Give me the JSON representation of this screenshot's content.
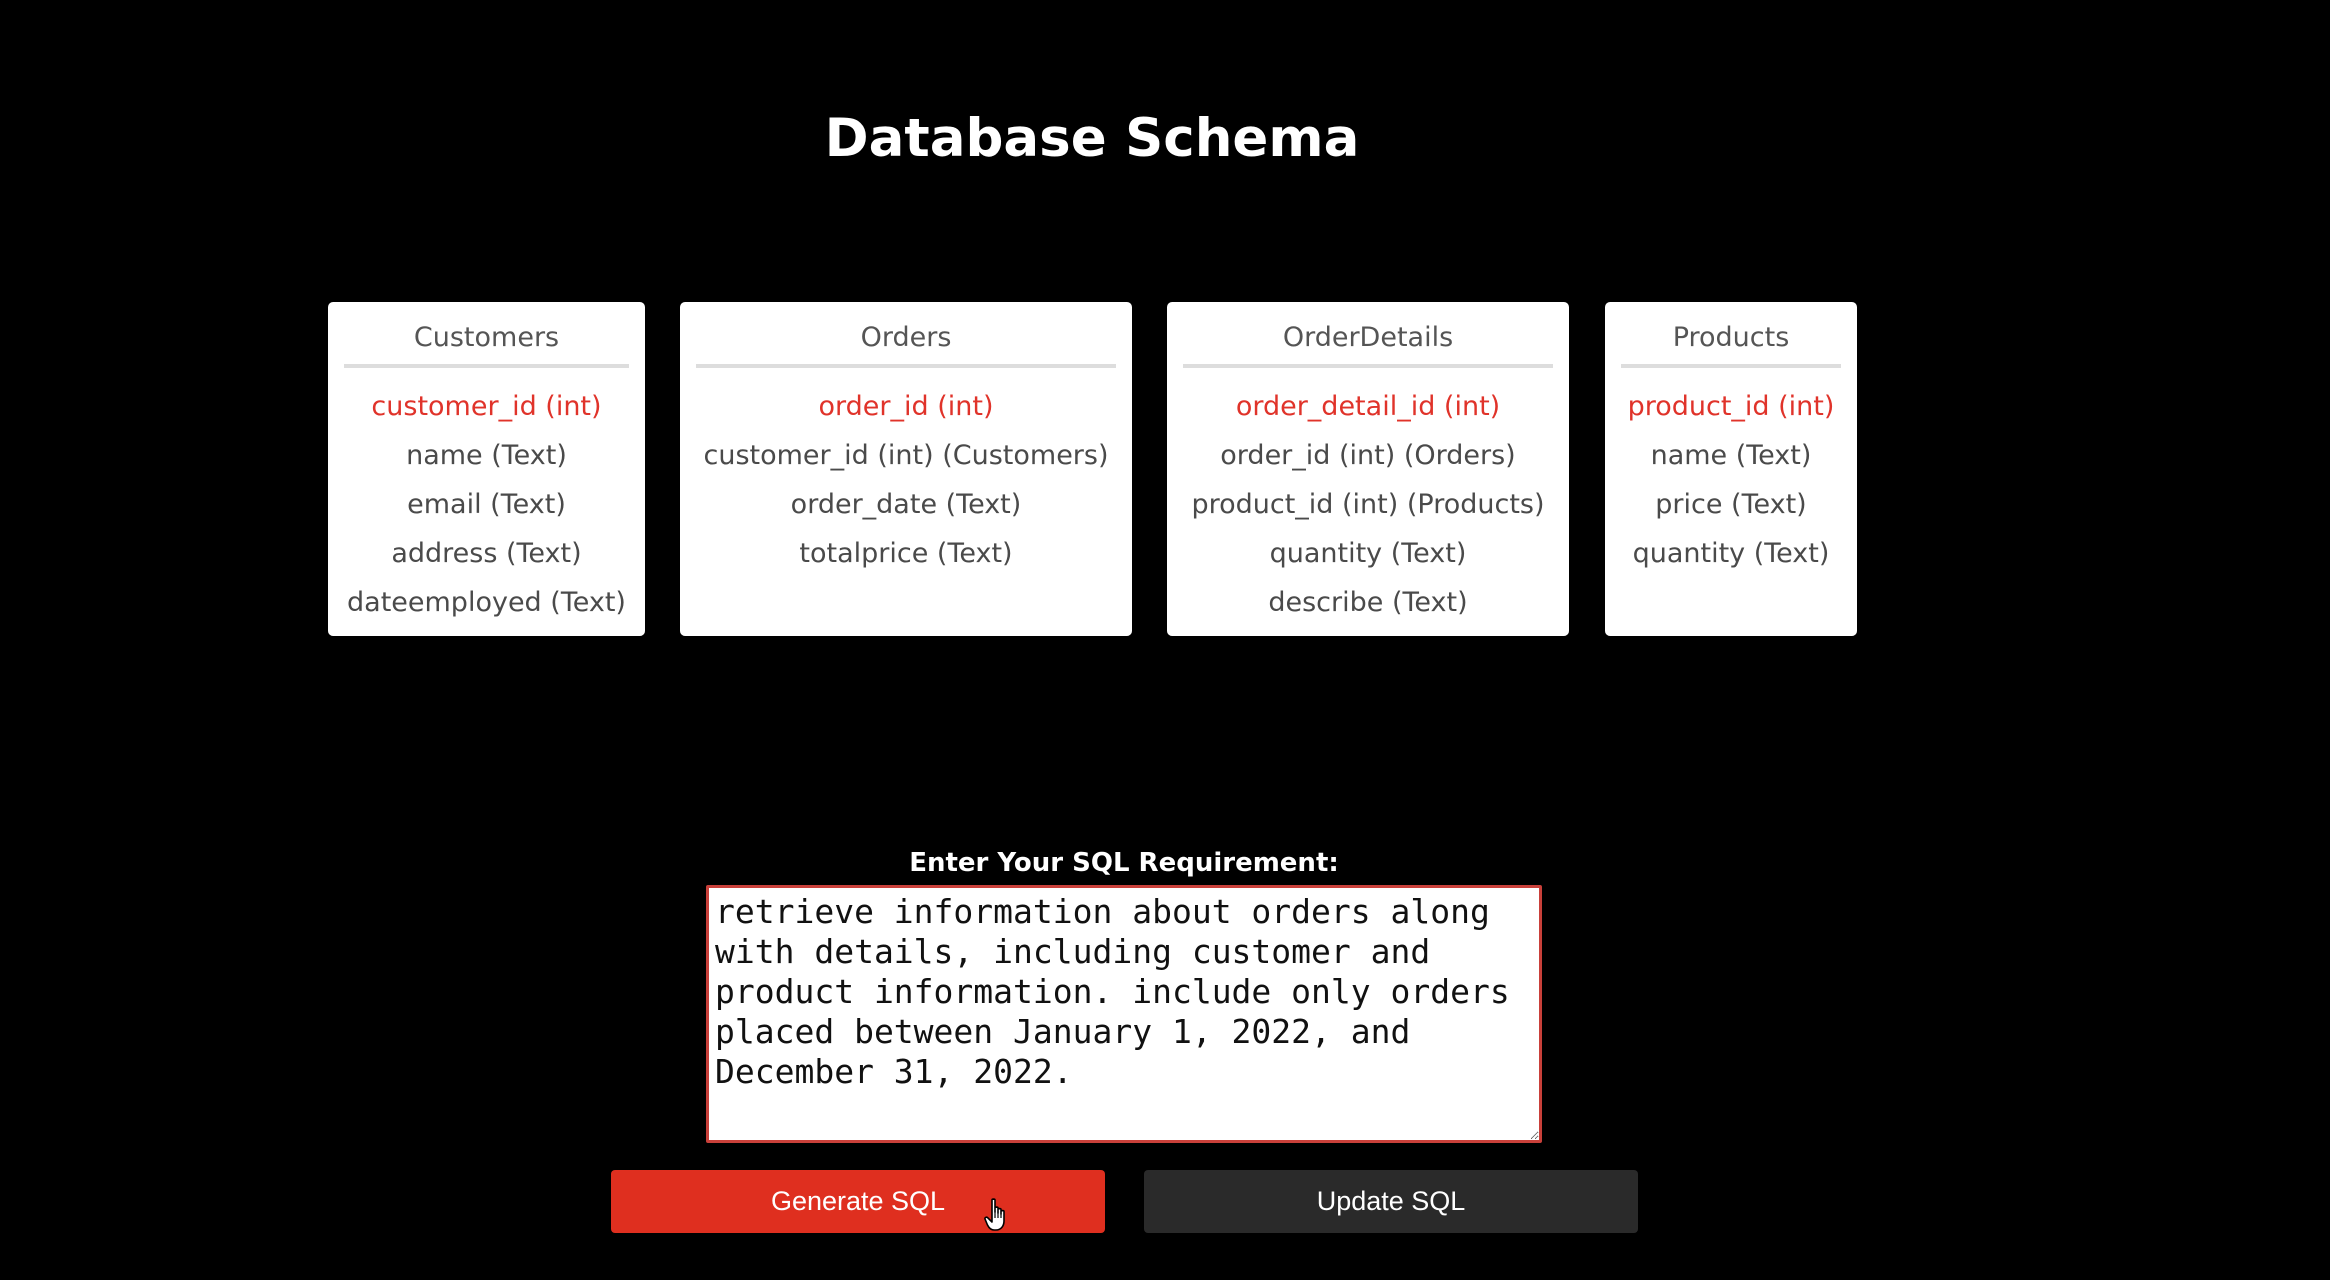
{
  "page": {
    "title": "Database Schema"
  },
  "tables": [
    {
      "name": "Customers",
      "columns": [
        {
          "label": "customer_id (int)",
          "primary": true
        },
        {
          "label": "name (Text)",
          "primary": false
        },
        {
          "label": "email (Text)",
          "primary": false
        },
        {
          "label": "address (Text)",
          "primary": false
        },
        {
          "label": "dateemployed (Text)",
          "primary": false
        }
      ]
    },
    {
      "name": "Orders",
      "columns": [
        {
          "label": "order_id (int)",
          "primary": true
        },
        {
          "label": "customer_id (int) (Customers)",
          "primary": false
        },
        {
          "label": "order_date (Text)",
          "primary": false
        },
        {
          "label": "totalprice (Text)",
          "primary": false
        }
      ]
    },
    {
      "name": "OrderDetails",
      "columns": [
        {
          "label": "order_detail_id (int)",
          "primary": true
        },
        {
          "label": "order_id (int) (Orders)",
          "primary": false
        },
        {
          "label": "product_id (int) (Products)",
          "primary": false
        },
        {
          "label": "quantity (Text)",
          "primary": false
        },
        {
          "label": "describe (Text)",
          "primary": false
        }
      ]
    },
    {
      "name": "Products",
      "columns": [
        {
          "label": "product_id (int)",
          "primary": true
        },
        {
          "label": "name (Text)",
          "primary": false
        },
        {
          "label": "price (Text)",
          "primary": false
        },
        {
          "label": "quantity (Text)",
          "primary": false
        }
      ]
    }
  ],
  "requirement": {
    "label": "Enter Your SQL Requirement:",
    "value": "retrieve information about orders along with details, including customer and product information. include only orders placed between January 1, 2022, and December 31, 2022."
  },
  "buttons": {
    "generate": "Generate SQL",
    "update": "Update SQL"
  },
  "colors": {
    "background": "#000000",
    "primary_key": "#e0332a",
    "generate_button": "#df2f1f",
    "update_button": "#2a2a2a"
  }
}
